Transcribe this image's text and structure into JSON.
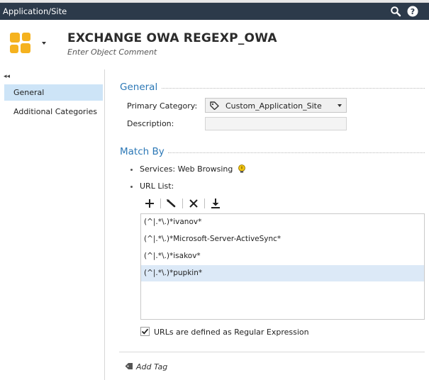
{
  "window": {
    "title": "Application/Site"
  },
  "header": {
    "title": "EXCHANGE OWA REGEXP_OWA",
    "comment_placeholder": "Enter Object Comment"
  },
  "nav": {
    "collapse_glyph": "◂◂",
    "items": [
      {
        "label": "General",
        "active": true
      },
      {
        "label": "Additional Categories",
        "active": false
      }
    ]
  },
  "general": {
    "section_title": "General",
    "primary_category_label": "Primary Category:",
    "primary_category_value": "Custom_Application_Site",
    "description_label": "Description:",
    "description_value": ""
  },
  "match_by": {
    "section_title": "Match By",
    "services_label": "Services: Web Browsing",
    "url_list_label": "URL List:",
    "urls": [
      "(^|.*\\.)*ivanov*",
      "(^|.*\\.)*Microsoft-Server-ActiveSync*",
      "(^|.*\\.)*isakov*",
      "(^|.*\\.)*pupkin*"
    ],
    "selected_index": 3,
    "regex_label": "URLs are defined as Regular Expression",
    "regex_checked": true
  },
  "footer": {
    "add_tag_label": "Add Tag"
  },
  "colors": {
    "titlebar_bg": "#2c3a4a",
    "accent": "#2c78b6",
    "nav_active": "#cde4f7",
    "row_selected": "#dce9f7",
    "app_icon": "#f5b21e"
  }
}
